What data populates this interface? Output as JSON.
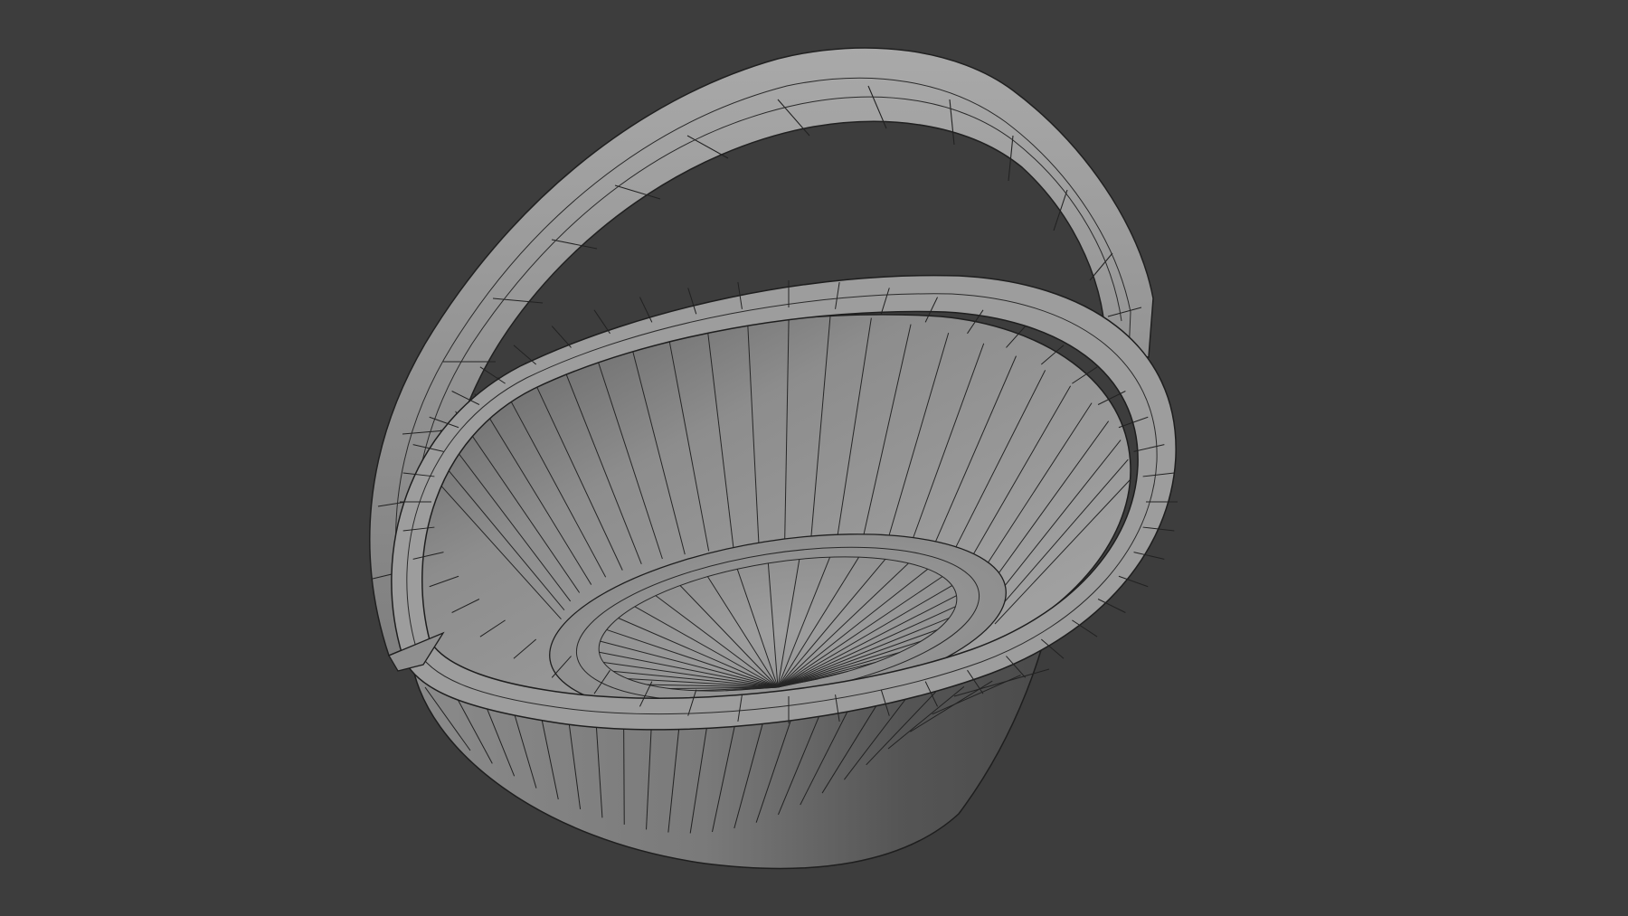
{
  "viewport": {
    "background_color": "#3d3d3d",
    "shading": "solid",
    "overlay": "wireframe"
  },
  "model": {
    "object": "basket",
    "parts": [
      "handle",
      "rim",
      "body",
      "bottom"
    ],
    "surface_color": "#9a9a9a",
    "wire_color": "#1e1e1e"
  }
}
